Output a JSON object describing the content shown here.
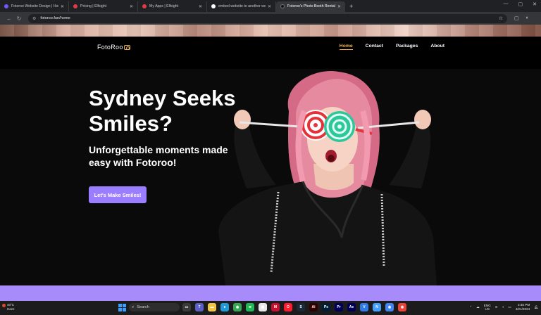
{
  "browser": {
    "tabs": [
      {
        "title": "Fotoroo Website Design | Hom",
        "favicon_color": "#6b5bff",
        "active": false
      },
      {
        "title": "Pricing | Elfsight",
        "favicon_color": "#e5384b",
        "active": false
      },
      {
        "title": "My Apps | Elfsight",
        "favicon_color": "#e5384b",
        "active": false
      },
      {
        "title": "embed website to another wel",
        "favicon_color": "#ffffff",
        "active": false
      },
      {
        "title": "Fotoroo's Photo Booth Rental",
        "favicon_color": "#111111",
        "active": true
      }
    ],
    "new_tab_symbol": "+",
    "url": "fotoroo.fun/home",
    "window_controls": [
      "—",
      "▢",
      "✕"
    ]
  },
  "site": {
    "logo_text": "FotoRoo",
    "nav": [
      {
        "label": "Home",
        "active": true
      },
      {
        "label": "Contact",
        "active": false
      },
      {
        "label": "Packages",
        "active": false
      },
      {
        "label": "About",
        "active": false
      }
    ],
    "hero": {
      "title": "Sydney Seeks Smiles?",
      "subtitle": "Unforgettable moments made easy with Fotoroo!",
      "cta_label": "Let's Make Smiles!",
      "cta_color": "#9b7dff"
    },
    "accent_color": "#f2b14b",
    "strip_color": "#a78bfa"
  },
  "taskbar": {
    "weather_temp": "40°C",
    "weather_desc": "Haze",
    "search_label": "Search",
    "apps": [
      {
        "name": "task-view",
        "color": "#3a3a3a",
        "glyph": "▭"
      },
      {
        "name": "teams",
        "color": "#5b5fc7",
        "glyph": "T"
      },
      {
        "name": "file-explorer",
        "color": "#f4c542",
        "glyph": "▬"
      },
      {
        "name": "edge",
        "color": "#1f9ad6",
        "glyph": "e"
      },
      {
        "name": "chrome",
        "color": "#34a853",
        "glyph": "◉"
      },
      {
        "name": "spotify",
        "color": "#1db954",
        "glyph": "≋"
      },
      {
        "name": "store",
        "color": "#e8e8e8",
        "glyph": "▦"
      },
      {
        "name": "mcafee",
        "color": "#c8102e",
        "glyph": "M"
      },
      {
        "name": "opera",
        "color": "#ff1b2d",
        "glyph": "O"
      },
      {
        "name": "steam",
        "color": "#1b2838",
        "glyph": "S"
      },
      {
        "name": "illustrator",
        "color": "#330000",
        "glyph": "Ai"
      },
      {
        "name": "photoshop",
        "color": "#001e36",
        "glyph": "Ps"
      },
      {
        "name": "premiere",
        "color": "#00005b",
        "glyph": "Pr"
      },
      {
        "name": "after-effects",
        "color": "#00005b",
        "glyph": "Ae"
      },
      {
        "name": "vpn",
        "color": "#2f7be5",
        "glyph": "V"
      },
      {
        "name": "notepad",
        "color": "#44a0ff",
        "glyph": "N"
      },
      {
        "name": "chrome-2",
        "color": "#4285f4",
        "glyph": "◉"
      },
      {
        "name": "chrome-3",
        "color": "#ea4335",
        "glyph": "◉"
      }
    ],
    "language": "ENG",
    "region": "US",
    "time": "3:45 PM",
    "date": "4/21/2024"
  }
}
